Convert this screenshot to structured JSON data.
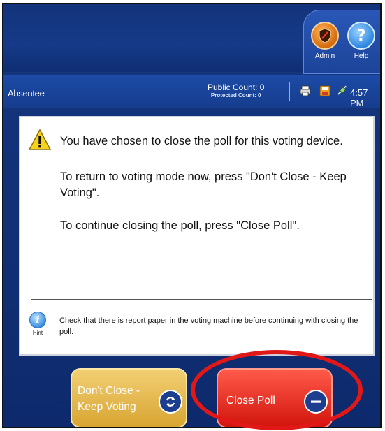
{
  "toolbar": {
    "admin_label": "Admin",
    "help_label": "Help",
    "help_glyph": "?"
  },
  "status": {
    "mode": "Absentee",
    "public_count": "Public Count: 0",
    "protected_count": "Protected Count: 0",
    "time": "4:57 PM",
    "icons": [
      "print-icon",
      "save-icon",
      "power-plug-icon"
    ]
  },
  "dialog": {
    "line1": "You have chosen to close the poll for this voting device.",
    "line2": "To return to voting mode now, press \"Don't Close - Keep Voting\".",
    "line3": "To continue closing the poll, press \"Close Poll\".",
    "hint_label": "Hint",
    "hint_glyph": "i",
    "hint_text": "Check that there is report paper in the voting machine before continuing with closing the poll."
  },
  "buttons": {
    "keep_line1": "Don't Close -",
    "keep_line2": "Keep Voting",
    "close_label": "Close Poll"
  },
  "colors": {
    "header_blue": "#13347c",
    "keep_button": "#e2b84a",
    "close_button": "#e8281b",
    "annotation_red": "#e11818"
  }
}
